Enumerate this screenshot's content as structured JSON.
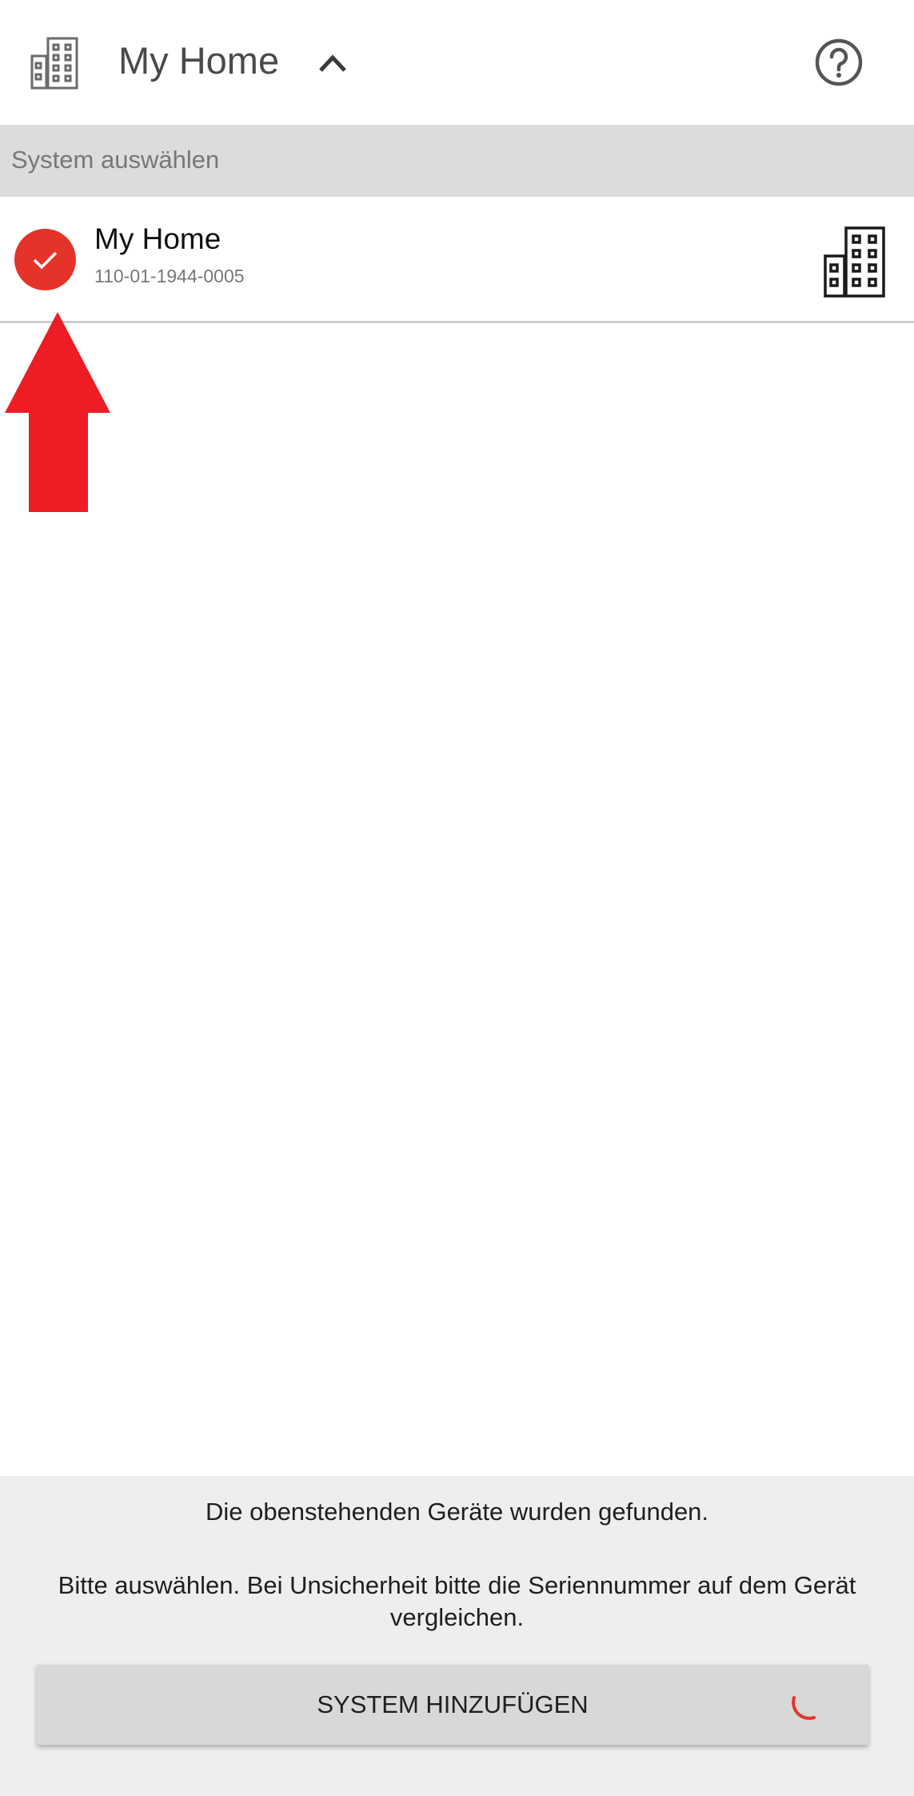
{
  "header": {
    "title": "My Home",
    "icons": [
      "building-icon",
      "chevron-up-icon",
      "help-circle-icon"
    ]
  },
  "section": {
    "title": "System auswählen"
  },
  "systems": [
    {
      "name": "My Home",
      "serial": "110-01-1944-0005",
      "selected": true,
      "icon": "building-icon"
    }
  ],
  "footer": {
    "message_found": "Die obenstehenden Geräte wurden gefunden.",
    "message_select": "Bitte auswählen. Bei Unsicherheit bitte die Seriennummer auf dem Gerät vergleichen.",
    "add_button_label": "SYSTEM HINZUFÜGEN",
    "loading": true
  },
  "colors": {
    "accent": "#e5332a",
    "annotation_arrow": "#ee1c25",
    "section_bg": "#dcdcdc",
    "footer_bg": "#eeeeee",
    "button_bg": "#d8d8d8"
  }
}
